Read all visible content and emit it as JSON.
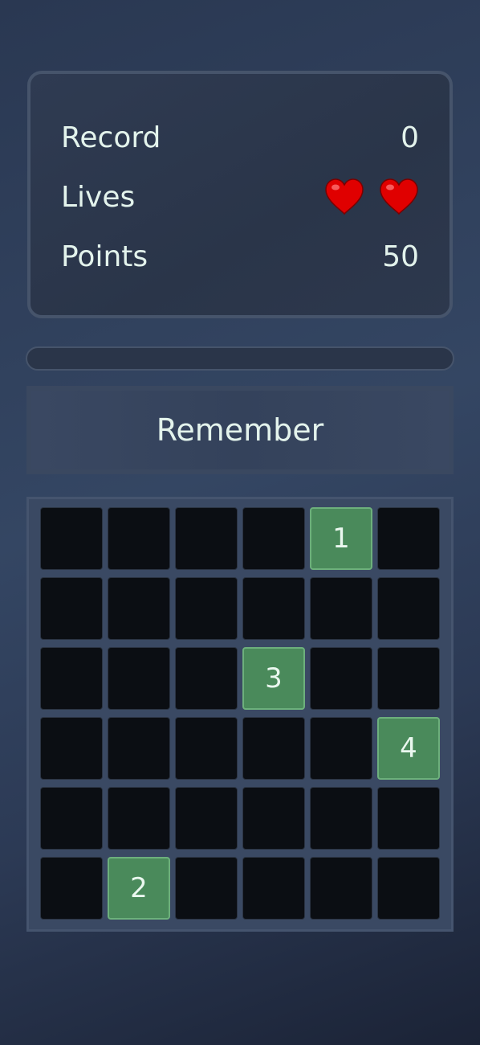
{
  "stats": {
    "record_label": "Record",
    "record_value": "0",
    "lives_label": "Lives",
    "lives_count": 2,
    "lives_icon": "heart-icon",
    "heart_color": "#e00000",
    "points_label": "Points",
    "points_value": "50"
  },
  "progress": {
    "value": 0
  },
  "phase": {
    "label": "Remember"
  },
  "grid": {
    "rows": 6,
    "cols": 6,
    "cells": [
      [
        "",
        "",
        "",
        "",
        "1",
        ""
      ],
      [
        "",
        "",
        "",
        "",
        "",
        ""
      ],
      [
        "",
        "",
        "",
        "3",
        "",
        ""
      ],
      [
        "",
        "",
        "",
        "",
        "",
        "4"
      ],
      [
        "",
        "",
        "",
        "",
        "",
        ""
      ],
      [
        "",
        "2",
        "",
        "",
        "",
        ""
      ]
    ],
    "revealed_color": "#4a8a5b",
    "hidden_color": "#0b0e13"
  }
}
